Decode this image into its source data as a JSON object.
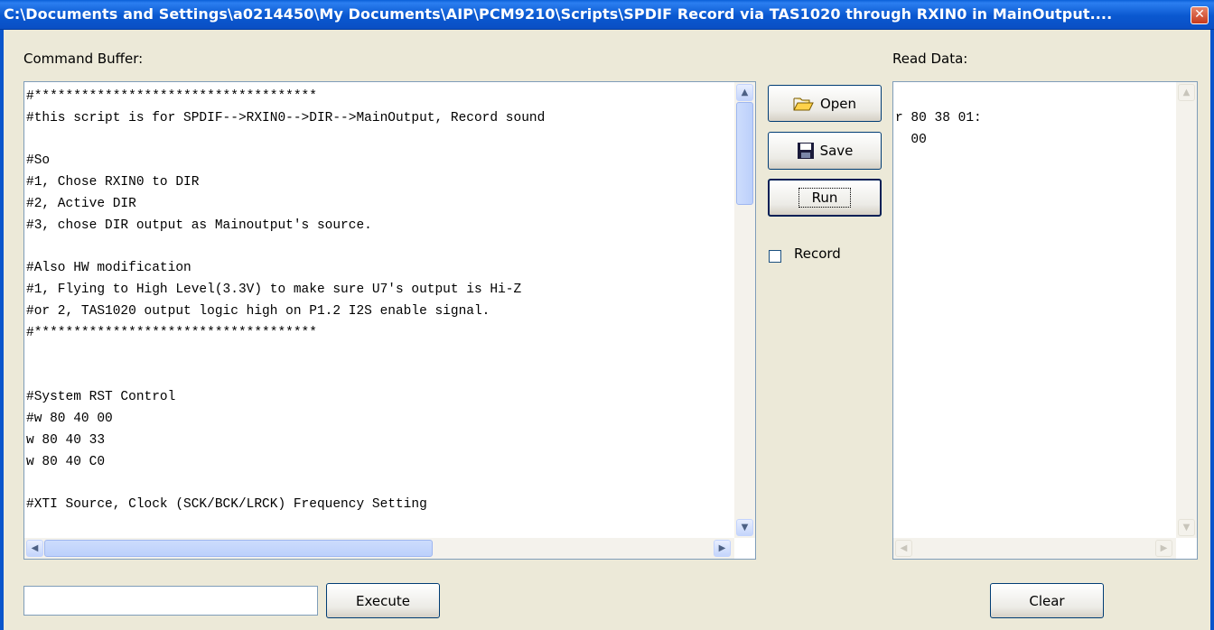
{
  "window": {
    "title": "C:\\Documents and Settings\\a0214450\\My Documents\\AIP\\PCM9210\\Scripts\\SPDIF Record via TAS1020 through RXIN0 in MainOutput....",
    "close_icon": "close-icon"
  },
  "command_buffer": {
    "label": "Command Buffer:",
    "lines": [
      "#************************************",
      "#this script is for SPDIF-->RXIN0-->DIR-->MainOutput, Record sound",
      "",
      "#So",
      "#1, Chose RXIN0 to DIR",
      "#2, Active DIR",
      "#3, chose DIR output as Mainoutput's source.",
      "",
      "#Also HW modification",
      "#1, Flying to High Level(3.3V) to make sure U7's output is Hi-Z",
      "#or 2, TAS1020 output logic high on P1.2 I2S enable signal.",
      "#************************************",
      "",
      "",
      "#System RST Control",
      "#w 80 40 00",
      "w 80 40 33",
      "w 80 40 C0",
      "",
      "#XTI Source, Clock (SCK/BCK/LRCK) Frequency Setting"
    ]
  },
  "buttons": {
    "open": "Open",
    "save": "Save",
    "run": "Run",
    "execute": "Execute",
    "clear": "Clear"
  },
  "record": {
    "label": "Record",
    "checked": false
  },
  "read_data": {
    "label": "Read Data:",
    "lines": [
      "r 80 38 01:",
      "  00"
    ]
  },
  "execute_input": {
    "value": ""
  }
}
